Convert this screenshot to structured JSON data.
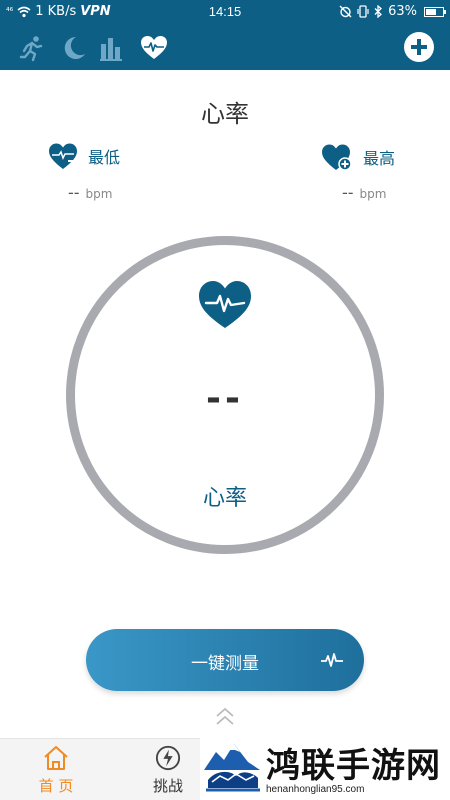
{
  "status_bar": {
    "signal": "⁴⁶",
    "speed": "1 KB/s",
    "vpn": "VPN",
    "time": "14:15",
    "battery": "63%",
    "battery_level": 0.63
  },
  "tabs": [
    {
      "icon": "running-icon"
    },
    {
      "icon": "moon-sleep-icon"
    },
    {
      "icon": "bar-chart-icon"
    },
    {
      "icon": "heart-rate-icon",
      "active": true
    }
  ],
  "page": {
    "title": "心率",
    "min_label": "最低",
    "max_label": "最高",
    "min_value": "--",
    "max_value": "--",
    "unit": "bpm",
    "current_value": "--",
    "ring_label": "心率"
  },
  "measure_button": {
    "label": "一键测量"
  },
  "bottom_nav": [
    {
      "label": "首 页",
      "icon": "home-icon",
      "active": true
    },
    {
      "label": "挑战",
      "icon": "lightning-icon"
    }
  ],
  "watermark": {
    "title": "鸿联手游网",
    "url": "henanhonglian95.com"
  },
  "colors": {
    "primary": "#0d5f86",
    "ring": "#a8aaaf",
    "nav_active": "#f08a24"
  }
}
